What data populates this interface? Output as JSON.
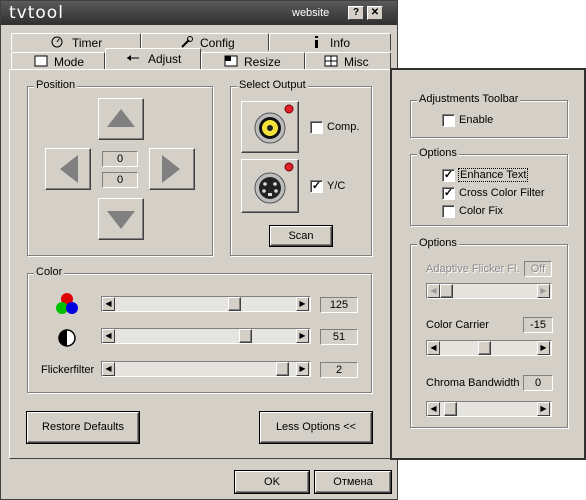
{
  "titlebar": {
    "app_title": "tvtool",
    "website_label": "website",
    "help_label": "?",
    "close_label": "✕"
  },
  "tabs": {
    "timer": "Timer",
    "config": "Config",
    "info": "Info",
    "mode": "Mode",
    "adjust": "Adjust",
    "resize": "Resize",
    "misc": "Misc"
  },
  "position": {
    "title": "Position",
    "x_value": "0",
    "y_value": "0"
  },
  "select_output": {
    "title": "Select Output",
    "comp_label": "Comp.",
    "comp_checked": false,
    "yc_label": "Y/C",
    "yc_checked": true,
    "scan_label": "Scan"
  },
  "color": {
    "title": "Color",
    "saturation": {
      "value": "125",
      "fraction": 0.67
    },
    "contrast": {
      "value": "51",
      "fraction": 0.74
    },
    "flickerfilter": {
      "label": "Flickerfilter",
      "value": "2",
      "fraction": 0.96
    }
  },
  "buttons": {
    "restore_defaults": "Restore Defaults",
    "less_options": "Less Options <<",
    "ok": "OK",
    "cancel": "Отмена"
  },
  "adjustments_toolbar": {
    "title": "Adjustments Toolbar",
    "enable_label": "Enable",
    "enable_checked": false
  },
  "options1": {
    "title": "Options",
    "enhance_text_label": "Enhance Text",
    "enhance_text_checked": true,
    "cross_color_label": "Cross Color Filter",
    "cross_color_checked": true,
    "color_fix_label": "Color Fix",
    "color_fix_checked": false
  },
  "options2": {
    "title": "Options",
    "adaptive_flicker": {
      "label": "Adaptive Flicker Fl.",
      "value": "Off",
      "fraction": 0.0,
      "disabled": true
    },
    "color_carrier": {
      "label": "Color Carrier",
      "value": "-15",
      "fraction": 0.45
    },
    "chroma_bandwidth": {
      "label": "Chroma Bandwidth",
      "value": "0",
      "fraction": 0.05
    }
  },
  "colors": {
    "titlebar": "#3a3a3a",
    "face": "#d4d0c8",
    "led_red": "#e0202a"
  }
}
